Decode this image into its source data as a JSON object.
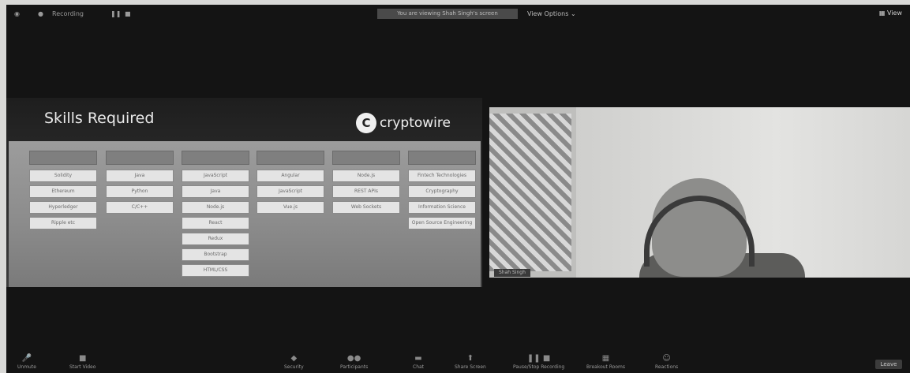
{
  "topbar": {
    "recording": "Recording",
    "share_banner": "You are viewing Shah Singh's screen",
    "view_options": "View Options",
    "view_button": "View"
  },
  "slide": {
    "title": "Skills Required",
    "logo_text": "cryptowire",
    "columns": [
      {
        "header": "",
        "items": [
          "Solidity",
          "Ethereum",
          "Hyperledger",
          "Ripple etc"
        ]
      },
      {
        "header": "",
        "items": [
          "Java",
          "Python",
          "C/C++"
        ]
      },
      {
        "header": "",
        "items": [
          "JavaScript",
          "Java",
          "Node.js",
          "React",
          "Redux",
          "Bootstrap",
          "HTML/CSS"
        ]
      },
      {
        "header": "",
        "items": [
          "Angular",
          "JavaScript",
          "Vue.js"
        ]
      },
      {
        "header": "",
        "items": [
          "Node.js",
          "REST APIs",
          "Web Sockets"
        ]
      },
      {
        "header": "",
        "items": [
          "Fintech Technologies",
          "Cryptography",
          "Information Science",
          "Open Source Engineering"
        ]
      }
    ]
  },
  "video": {
    "name": "Shah Singh"
  },
  "toolbar": {
    "unmute": "Unmute",
    "start_video": "Start Video",
    "security": "Security",
    "participants": "Participants",
    "chat": "Chat",
    "share": "Share Screen",
    "pause": "Pause/Stop Recording",
    "breakout": "Breakout Rooms",
    "reactions": "Reactions",
    "leave": "Leave"
  },
  "colors": {
    "window_bg": "#141414",
    "pill_bg": "#e4e4e4"
  }
}
